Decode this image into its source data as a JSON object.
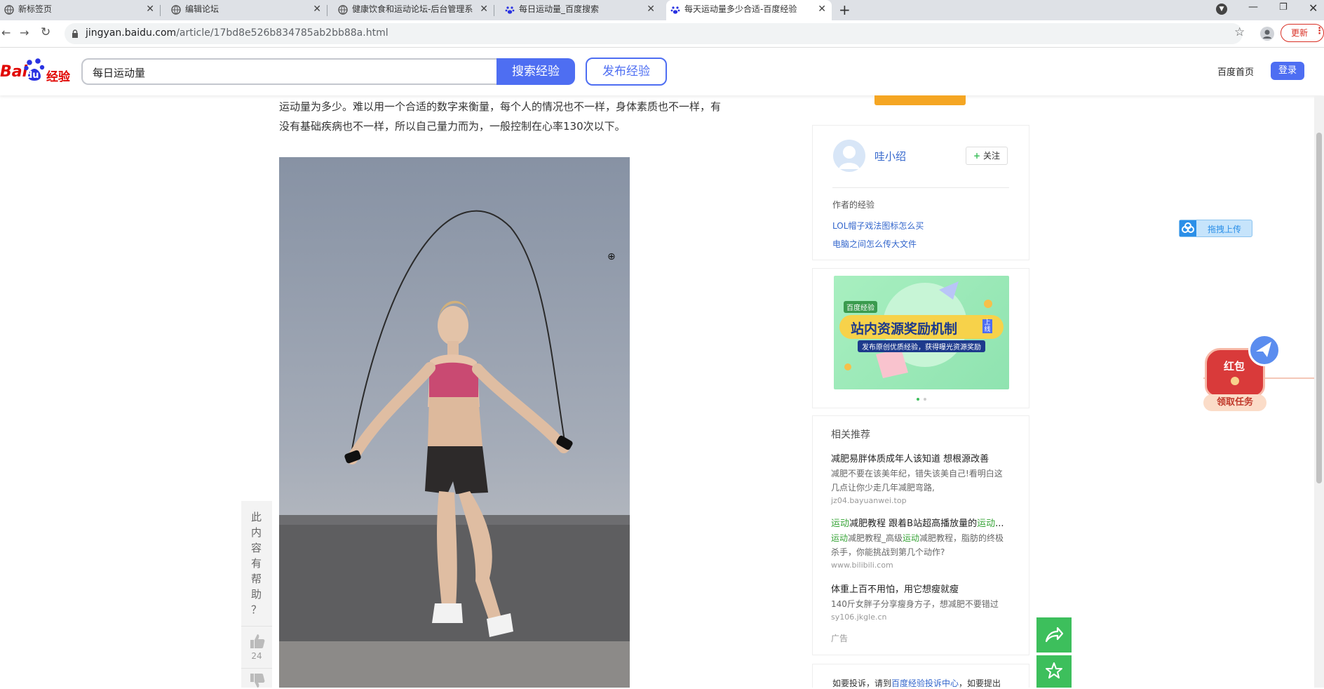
{
  "browser": {
    "tabs": [
      {
        "title": "新标签页",
        "active": false
      },
      {
        "title": "编辑论坛",
        "active": false
      },
      {
        "title": "健康饮食和运动论坛-后台管理系",
        "active": false
      },
      {
        "title": "每日运动量_百度搜索",
        "active": false
      },
      {
        "title": "每天运动量多少合适-百度经验",
        "active": true
      }
    ],
    "new_tab": "+",
    "url_domain": "jingyan.baidu.com",
    "url_path": "/article/17bd8e526b834785ab2bb88a.html",
    "update_label": "更新"
  },
  "header": {
    "logo_text": "Bai",
    "logo_du": "du",
    "logo_jingyan": "经验",
    "search_value": "每日运动量",
    "search_button": "搜索经验",
    "publish_button": "发布经验",
    "home_link": "百度首页",
    "login_button": "登录"
  },
  "article": {
    "line1": "运动量为多少。难以用一个合适的数字来衡量，每个人的情况也不一样，身体素质也不一样，有",
    "line2": "没有基础疾病也不一样，所以自己量力而为，一般控制在心率130次以下。"
  },
  "helpful": {
    "chars": [
      "此",
      "内",
      "容",
      "有",
      "帮",
      "助",
      "？"
    ],
    "like_count": "24"
  },
  "author": {
    "name": "哇小绍",
    "follow": "关注",
    "section": "作者的经验",
    "links": [
      "LOL帽子戏法图标怎么买",
      "电脑之间怎么传大文件"
    ]
  },
  "banner": {
    "tag": "百度经验",
    "title": "站内资源奖励机制",
    "badge": "上线",
    "subtitle": "发布原创优质经验，获得曝光资源奖励"
  },
  "related": {
    "title": "相关推荐",
    "items": [
      {
        "title": "减肥易胖体质成年人该知道 想根源改善",
        "desc1": "减肥不要在该美年纪，错失该美自己!看明白这",
        "desc2": "几点让你少走几年减肥弯路,",
        "url": "jz04.bayuanwei.top"
      },
      {
        "title_hl1": "运动",
        "title_rest": "减肥教程 跟着B站超高播放量的",
        "title_hl2": "运动",
        "title_end": "...",
        "desc1_hl": "运动",
        "desc1_a": "减肥教程_高级",
        "desc1_hl2": "运动",
        "desc1_b": "减肥教程，脂肪的终极",
        "desc2": "杀手，你能挑战到第几个动作?",
        "url": "www.bilibili.com"
      },
      {
        "title": "体重上百不用怕，用它想瘦就瘦",
        "desc1": "140斤女胖子分享瘦身方子，想减肥不要错过",
        "url": "sy106.jkgle.cn"
      }
    ],
    "ad": "广告"
  },
  "complaint": {
    "a": "如要投诉，请到",
    "link": "百度经验投诉中心",
    "b": "，如要提出"
  },
  "upload_btn": "拖拽上传",
  "redpack": {
    "title": "红包",
    "task": "领取任务"
  },
  "colors": {
    "baidu_blue": "#4e6ef2",
    "green": "#3dbf5c",
    "orange": "#f5a623"
  }
}
